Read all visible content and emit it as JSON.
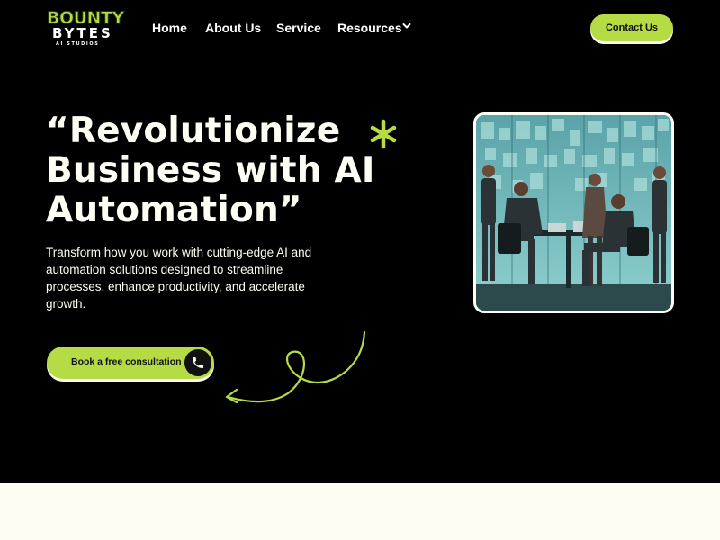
{
  "brand": {
    "logo_line1": "BOUNTY",
    "logo_line2": "BYTES",
    "logo_line3": "AI STUDIOS"
  },
  "nav": {
    "items": [
      {
        "label": "Home"
      },
      {
        "label": "About Us"
      },
      {
        "label": "Service"
      },
      {
        "label": "Resources"
      }
    ],
    "contact_label": "Contact Us"
  },
  "hero": {
    "headline_line1": "“Revolutionize",
    "headline_line2": "Business with AI",
    "headline_line3": "Automation”",
    "subtext": "Transform how you work with cutting-edge AI and automation solutions designed to streamline processes, enhance productivity, and accelerate growth.",
    "cta_label": "Book a free consultation"
  },
  "icons": {
    "accent_decoration": "asterisk-icon",
    "cta_icon": "phone-icon",
    "nav_dropdown": "chevron-down-icon",
    "arrow_decoration": "curly-arrow-icon"
  },
  "colors": {
    "background": "#000000",
    "accent": "#b6dc45",
    "text_light": "#fdfdf3"
  }
}
